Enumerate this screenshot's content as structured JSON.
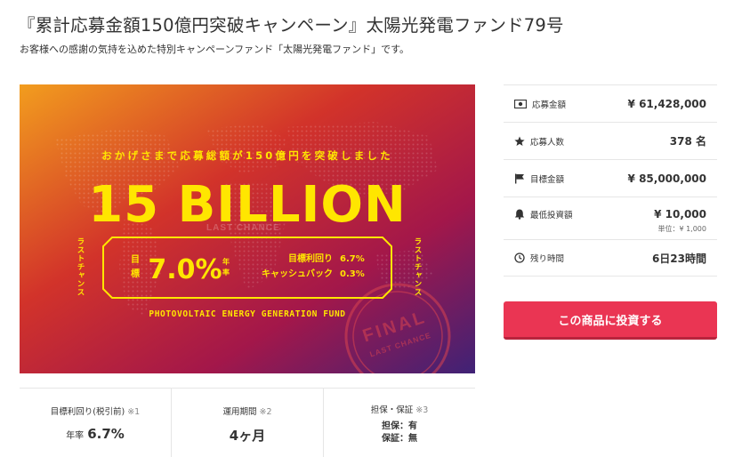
{
  "header": {
    "title": "『累計応募金額150億円突破キャンペーン』太陽光発電ファンド79号",
    "subtitle": "お客様への感謝の気持を込めた特別キャンペーンファンド「太陽光発電ファンド」です。"
  },
  "banner": {
    "tagline": "おかげさまで応募総額が150億円を突破しました",
    "headline": "15 BILLION",
    "left_vertical": "ラストチャンス",
    "right_vertical": "ラストチャンス",
    "target_label_1": "目",
    "target_label_2": "標",
    "target_rate": "7.0%",
    "per_year_1": "年",
    "per_year_2": "率",
    "yield_label": "目標利回り",
    "yield_value": "6.7%",
    "cashback_label": "キャッシュバック",
    "cashback_value": "0.3%",
    "stamp_top": "FINAL",
    "stamp_bottom": "LAST CHANCE",
    "stamp_ghost": "LAST CHANCE",
    "fund_name": "PHOTOVOLTAIC ENERGY GENERATION FUND",
    "colors": {
      "top": "#f29d1e",
      "mid": "#c8102e",
      "bottom": "#4a2378",
      "text": "#ffe600"
    }
  },
  "info": {
    "applied_amount_label": "応募金額",
    "applied_amount_value": "¥ 61,428,000",
    "applicants_label": "応募人数",
    "applicants_value": "378 名",
    "target_amount_label": "目標金額",
    "target_amount_value": "¥ 85,000,000",
    "min_investment_label": "最低投資額",
    "min_investment_value": "¥ 10,000",
    "min_investment_unit": "単位：¥ 1,000",
    "remaining_label": "残り時間",
    "remaining_value": "6日23時間"
  },
  "cta": {
    "label": "この商品に投資する",
    "color": "#ea3553"
  },
  "stats": {
    "yield_label": "目標利回り(税引前)",
    "yield_note": "※1",
    "yield_prefix": "年率",
    "yield_value": "6.7%",
    "period_label": "運用期間",
    "period_note": "※2",
    "period_value": "4ヶ月",
    "guarantee_label": "担保・保証",
    "guarantee_note": "※3",
    "collateral": "担保：有",
    "guarantee": "保証：無"
  },
  "icons": [
    "money-icon",
    "star-icon",
    "flag-icon",
    "bell-icon",
    "clock-icon"
  ]
}
